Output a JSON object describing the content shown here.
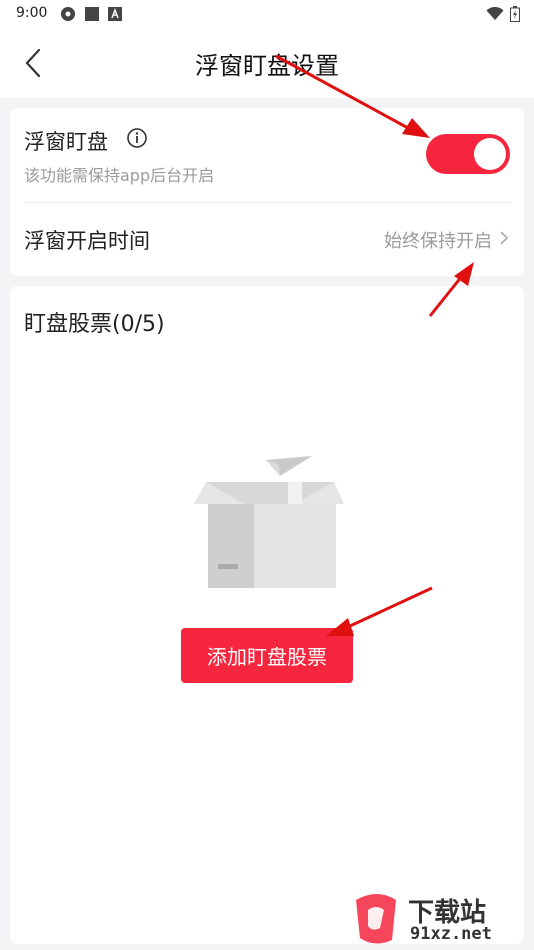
{
  "status_bar": {
    "time": "9:00",
    "icons_left": [
      "settings-icon",
      "square-icon",
      "a-icon"
    ],
    "icons_right": [
      "wifi-icon",
      "battery-icon"
    ]
  },
  "header": {
    "title": "浮窗盯盘设置",
    "back_icon": "chevron-left-icon"
  },
  "settings": {
    "float_watch": {
      "label": "浮窗盯盘",
      "description": "该功能需保持app后台开启",
      "enabled": true,
      "info_icon": "info-icon"
    },
    "float_time": {
      "label": "浮窗开启时间",
      "value": "始终保持开启"
    }
  },
  "stocks": {
    "title": "盯盘股票(0/5)",
    "add_button_label": "添加盯盘股票"
  },
  "watermark": {
    "main": "下载站",
    "sub": "91xz.net"
  },
  "colors": {
    "accent": "#f5263e",
    "background": "#f4f4f6",
    "annotation_arrow": "#e01010"
  }
}
